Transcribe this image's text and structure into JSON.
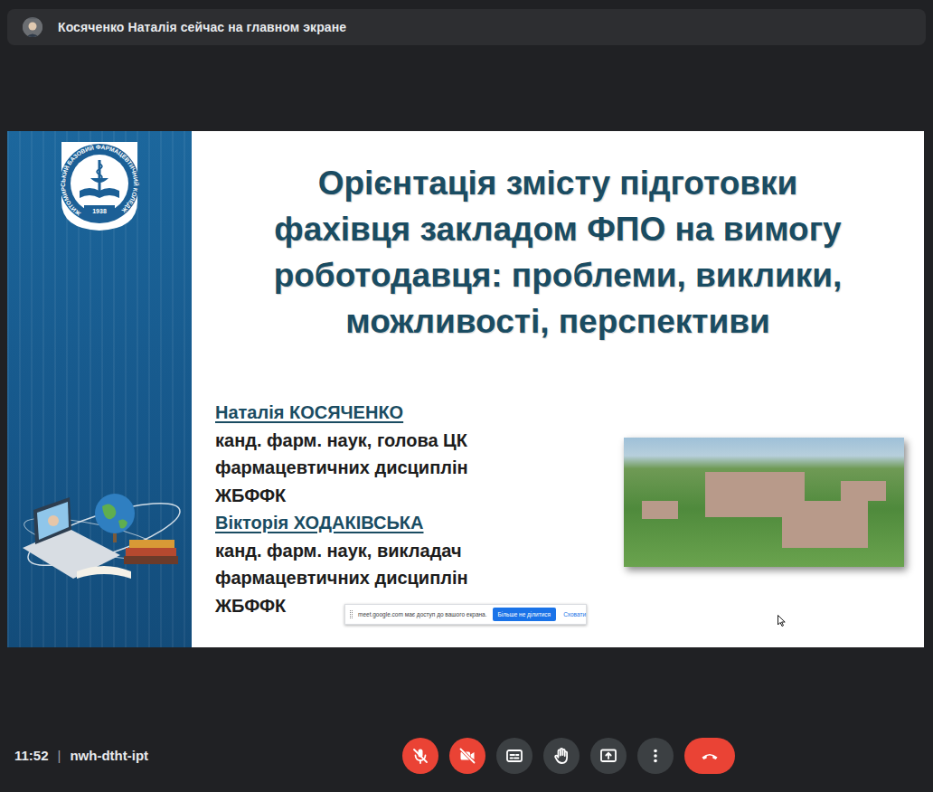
{
  "banner": {
    "text": "Косяченко Наталія сейчас на главном экране"
  },
  "slide": {
    "logo": {
      "ring_text": "ЖИТОМИРСЬКИЙ БАЗОВИЙ ФАРМАЦЕВТИЧНИЙ КОЛЕДЖ",
      "year": "1938"
    },
    "title_lines": [
      "Орієнтація змісту підготовки",
      "фахівця закладом ФПО на вимогу",
      "роботодавця: проблеми, виклики,",
      "можливості, перспективи"
    ],
    "authors": [
      {
        "name": "Наталія КОСЯЧЕНКО",
        "details": [
          "канд. фарм. наук, голова ЦК",
          "фармацевтичних дисциплін",
          "ЖБФФК"
        ]
      },
      {
        "name": "Вікторія ХОДАКІВСЬКА",
        "details": [
          "канд. фарм. наук, викладач",
          "фармацевтичних дисциплін",
          "ЖБФФК"
        ]
      }
    ]
  },
  "share_notice": {
    "text": "meet.google.com має доступ до вашого екрана.",
    "stop_button": "Більше не ділитися",
    "hide_button": "Сховати"
  },
  "bottom_bar": {
    "time": "11:52",
    "separator": "|",
    "meeting_code": "nwh-dtht-ipt",
    "controls": [
      {
        "kind": "mic",
        "off": true
      },
      {
        "kind": "camera",
        "off": true
      },
      {
        "kind": "captions",
        "off": false
      },
      {
        "kind": "hand",
        "off": false
      },
      {
        "kind": "present",
        "off": false
      },
      {
        "kind": "more",
        "off": false
      },
      {
        "kind": "hangup",
        "off": false
      }
    ]
  }
}
